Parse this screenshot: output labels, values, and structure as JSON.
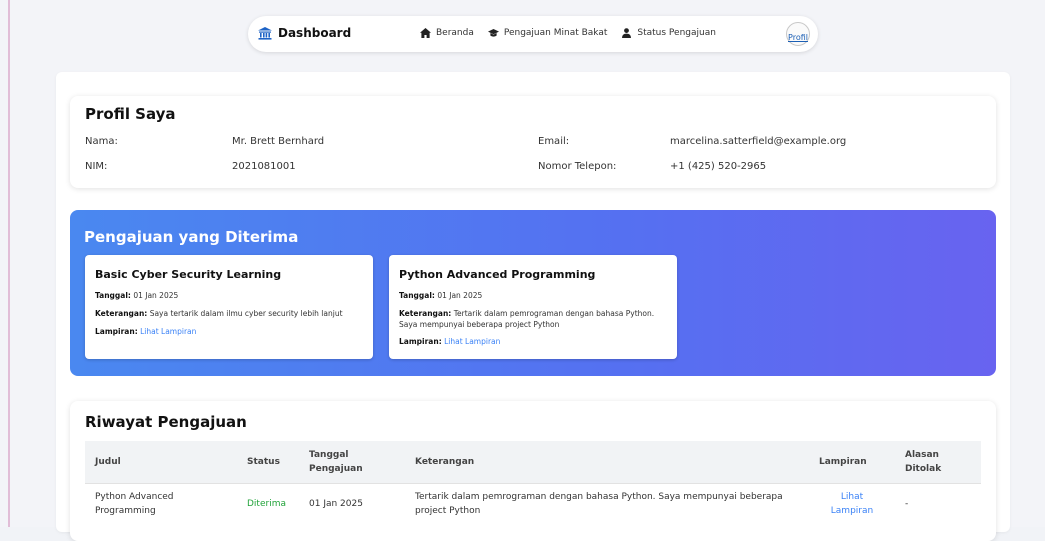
{
  "navbar": {
    "brand": "Dashboard",
    "links": [
      {
        "label": "Beranda",
        "icon": "home-icon"
      },
      {
        "label": "Pengajuan Minat Bakat",
        "icon": "graduation-cap-icon"
      },
      {
        "label": "Status Pengajuan",
        "icon": "user-icon"
      }
    ],
    "avatar_alt": "Profil"
  },
  "profile": {
    "title": "Profil Saya",
    "name_label": "Nama:",
    "name_value": "Mr. Brett Bernhard",
    "nim_label": "NIM:",
    "nim_value": "2021081001",
    "email_label": "Email:",
    "email_value": "marcelina.satterfield@example.org",
    "phone_label": "Nomor Telepon:",
    "phone_value": "+1 (425) 520-2965"
  },
  "accepted": {
    "title": "Pengajuan yang Diterima",
    "cards": [
      {
        "title": "Basic Cyber Security Learning",
        "date_label": "Tanggal:",
        "date": "01 Jan 2025",
        "note_label": "Keterangan:",
        "note": "Saya tertarik dalam ilmu cyber security lebih lanjut",
        "attach_label": "Lampiran:",
        "attach_link": "Lihat Lampiran"
      },
      {
        "title": "Python Advanced Programming",
        "date_label": "Tanggal:",
        "date": "01 Jan 2025",
        "note_label": "Keterangan:",
        "note_line1": "Tertarik dalam pemrograman dengan bahasa Python.",
        "note_line2": "Saya mempunyai beberapa project Python",
        "attach_label": "Lampiran:",
        "attach_link": "Lihat Lampiran"
      }
    ]
  },
  "history": {
    "title": "Riwayat Pengajuan",
    "headers": {
      "judul": "Judul",
      "status": "Status",
      "tanggal_1": "Tanggal",
      "tanggal_2": "Pengajuan",
      "keterangan": "Keterangan",
      "lampiran": "Lampiran",
      "alasan_1": "Alasan",
      "alasan_2": "Ditolak"
    },
    "rows": [
      {
        "judul_1": "Python Advanced",
        "judul_2": "Programming",
        "status": "Diterima",
        "tanggal": "01 Jan 2025",
        "keterangan_1": "Tertarik dalam pemrograman dengan bahasa Python. Saya mempunyai beberapa",
        "keterangan_2": "project Python",
        "lampiran_1": "Lihat",
        "lampiran_2": "Lampiran",
        "alasan": "-"
      }
    ]
  },
  "colors": {
    "accent": "#5570f1",
    "link": "#3b82f6",
    "status_accepted": "#22a33a"
  }
}
